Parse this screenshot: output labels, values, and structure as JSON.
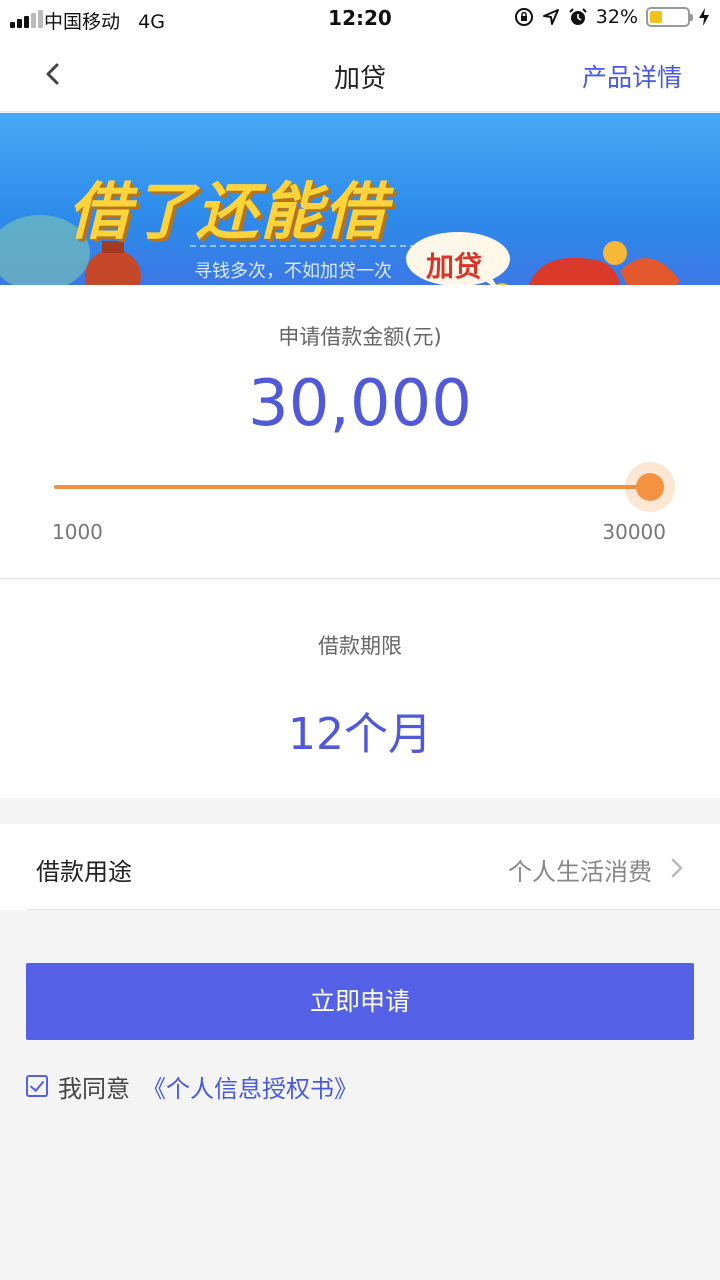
{
  "status_bar": {
    "carrier": "中国移动",
    "network": "4G",
    "time": "12:20",
    "battery": "32%",
    "battery_level": 0.32
  },
  "nav": {
    "title": "加贷",
    "right_link": "产品详情"
  },
  "banner": {
    "headline": "借了还能借",
    "subtitle": "寻钱多次，不如加贷一次",
    "badge": "加贷"
  },
  "amount": {
    "label": "申请借款金额(元)",
    "value": "30,000",
    "min_label": "1000",
    "max_label": "30000",
    "slider_value": 30000,
    "slider_min": 1000,
    "slider_max": 30000
  },
  "term": {
    "label": "借款期限",
    "value": "12个月"
  },
  "purpose": {
    "label": "借款用途",
    "value": "个人生活消费"
  },
  "actions": {
    "apply_label": "立即申请"
  },
  "agreement": {
    "checked": true,
    "text": "我同意",
    "link": "《个人信息授权书》"
  },
  "colors": {
    "accent": "#5460e5",
    "amount_text": "#5059d8",
    "slider": "#f09040",
    "link": "#4a5ae0"
  }
}
